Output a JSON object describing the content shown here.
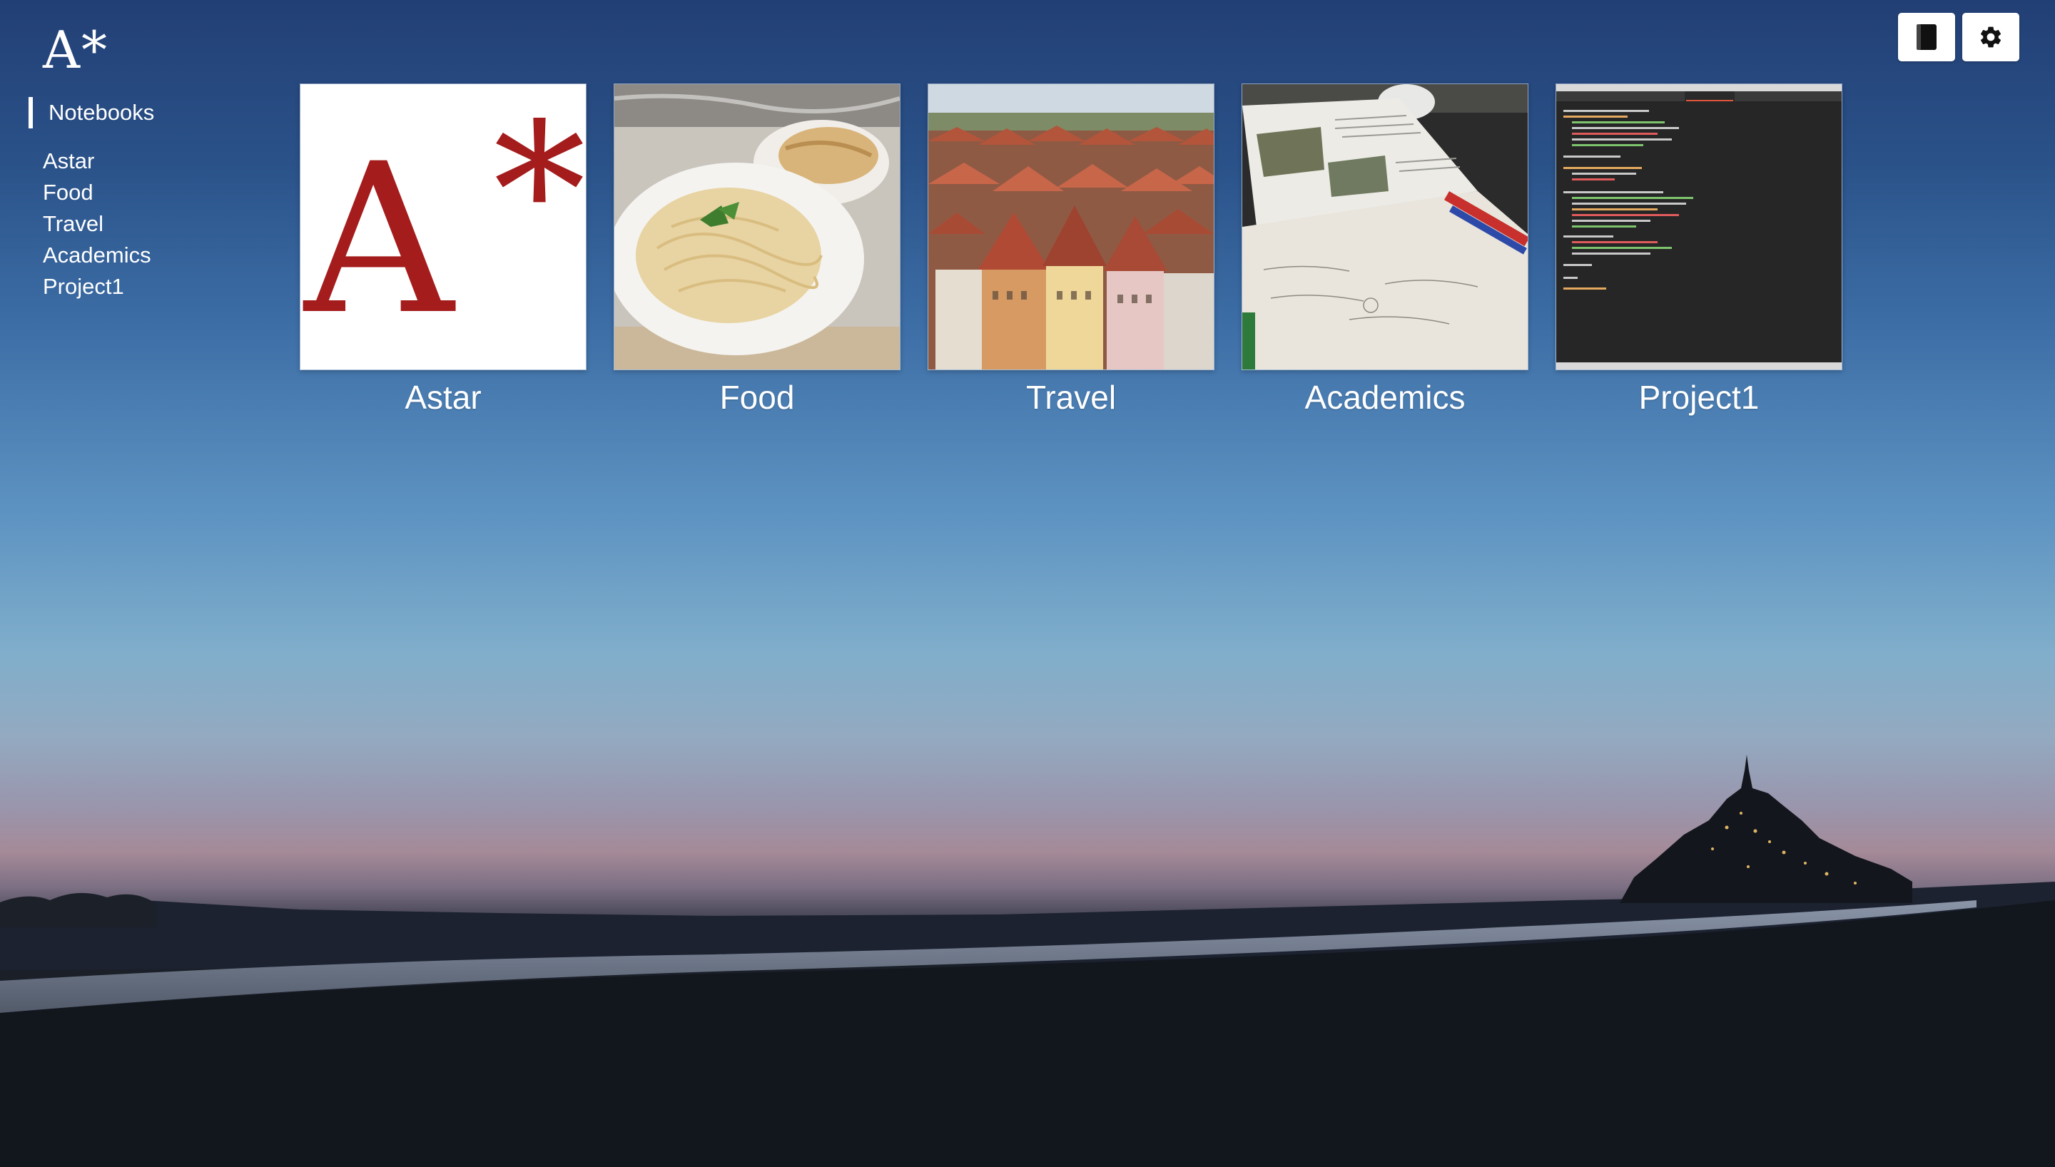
{
  "app": {
    "logo_text": "A*"
  },
  "sidebar": {
    "heading": "Notebooks",
    "items": [
      {
        "label": "Astar"
      },
      {
        "label": "Food"
      },
      {
        "label": "Travel"
      },
      {
        "label": "Academics"
      },
      {
        "label": "Project1"
      }
    ]
  },
  "toolbar": {
    "notebook_icon": "notebook-icon",
    "settings_icon": "gear-icon"
  },
  "notebooks": [
    {
      "label": "Astar",
      "thumbnail": "astar-logo"
    },
    {
      "label": "Food",
      "thumbnail": "pasta-plate-photo"
    },
    {
      "label": "Travel",
      "thumbnail": "old-town-rooftops-photo"
    },
    {
      "label": "Academics",
      "thumbnail": "textbook-and-notes-photo"
    },
    {
      "label": "Project1",
      "thumbnail": "code-editor-screenshot"
    }
  ],
  "colors": {
    "brand_red": "#a51c1c",
    "text": "#ffffff",
    "button_bg": "#ffffff"
  }
}
